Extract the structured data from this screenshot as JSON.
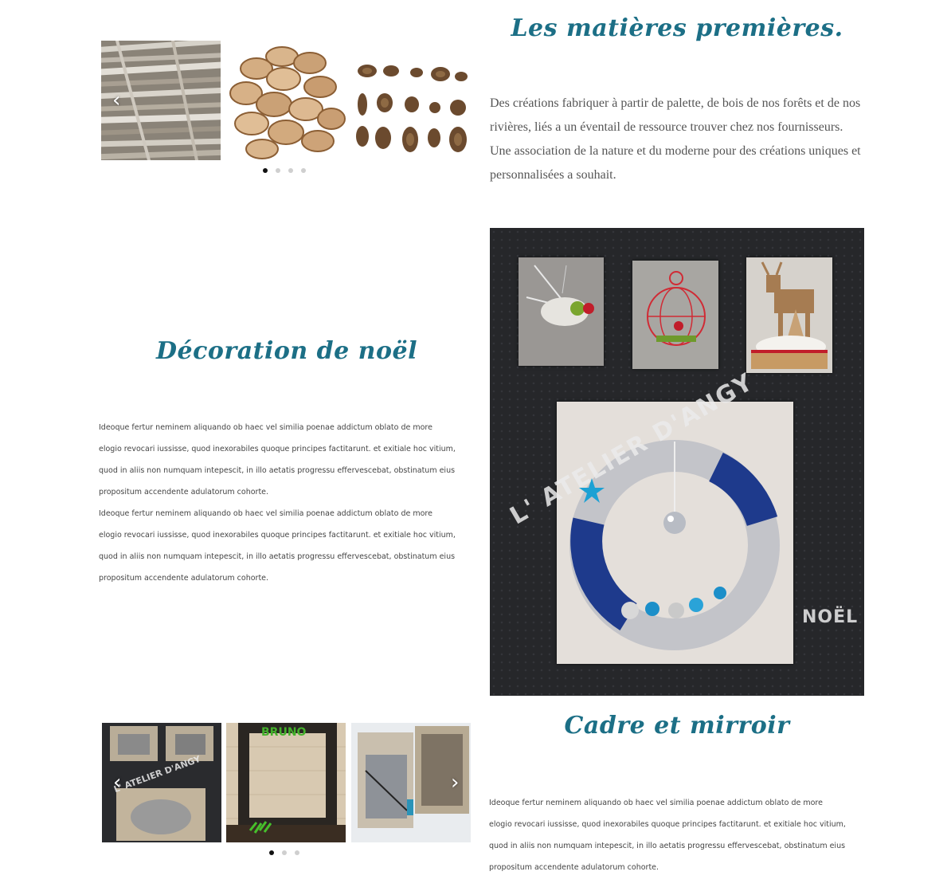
{
  "section1": {
    "title": "Les matières premières.",
    "paragraphs": [
      "Des créations fabriquer à partir de palette, de bois de nos forêts et de nos rivières, liés a un éventail de ressource trouver chez nos fournisseurs.",
      "Une association de la nature et du moderne pour des créations uniques et personnalisées a souhait."
    ],
    "carousel": {
      "slides": [
        "driftwood-branches",
        "wood-slices",
        "pine-cones"
      ],
      "prev_icon": "‹",
      "dots": 4,
      "active_dot": 0
    }
  },
  "section2": {
    "title": "Décoration de noël",
    "paragraphs": [
      "Ideoque fertur neminem aliquando ob haec vel similia poenae addictum oblato de more elogio revocari iussisse, quod inexorabiles quoque principes factitarunt. et exitiale hoc vitium, quod in aliis non numquam intepescit, in illo aetatis progressu effervescebat, obstinatum eius propositum accendente adulatorum cohorte.",
      "Ideoque fertur neminem aliquando ob haec vel similia poenae addictum oblato de more elogio revocari iussisse, quod inexorabiles quoque principes factitarunt. et exitiale hoc vitium, quod in aliis non numquam intepescit, in illo aetatis progressu effervescebat, obstinatum eius propositum accendente adulatorum cohorte."
    ],
    "image": {
      "watermark": "L' ATELIER D'ANGY",
      "caption": "NOËL"
    }
  },
  "section3": {
    "title": "Cadre et mirroir",
    "paragraphs": [
      "Ideoque fertur neminem aliquando ob haec vel similia poenae addictum oblato de more elogio revocari iussisse, quod inexorabiles quoque principes factitarunt. et exitiale hoc vitium, quod in aliis non numquam intepescit, in illo aetatis progressu effervescebat, obstinatum eius propositum accendente adulatorum cohorte."
    ],
    "carousel": {
      "slides": [
        "pallet-mirrors",
        "bruno-frame",
        "pallet-frames"
      ],
      "prev_icon": "‹",
      "next_icon": "›",
      "dots": 3,
      "active_dot": 0,
      "watermark": "L' ATELIER D'ANGY",
      "frame_text": "BRUNO"
    }
  },
  "colors": {
    "heading": "#1c6f86",
    "body_text": "#555555",
    "panel_bg": "#26272a"
  }
}
